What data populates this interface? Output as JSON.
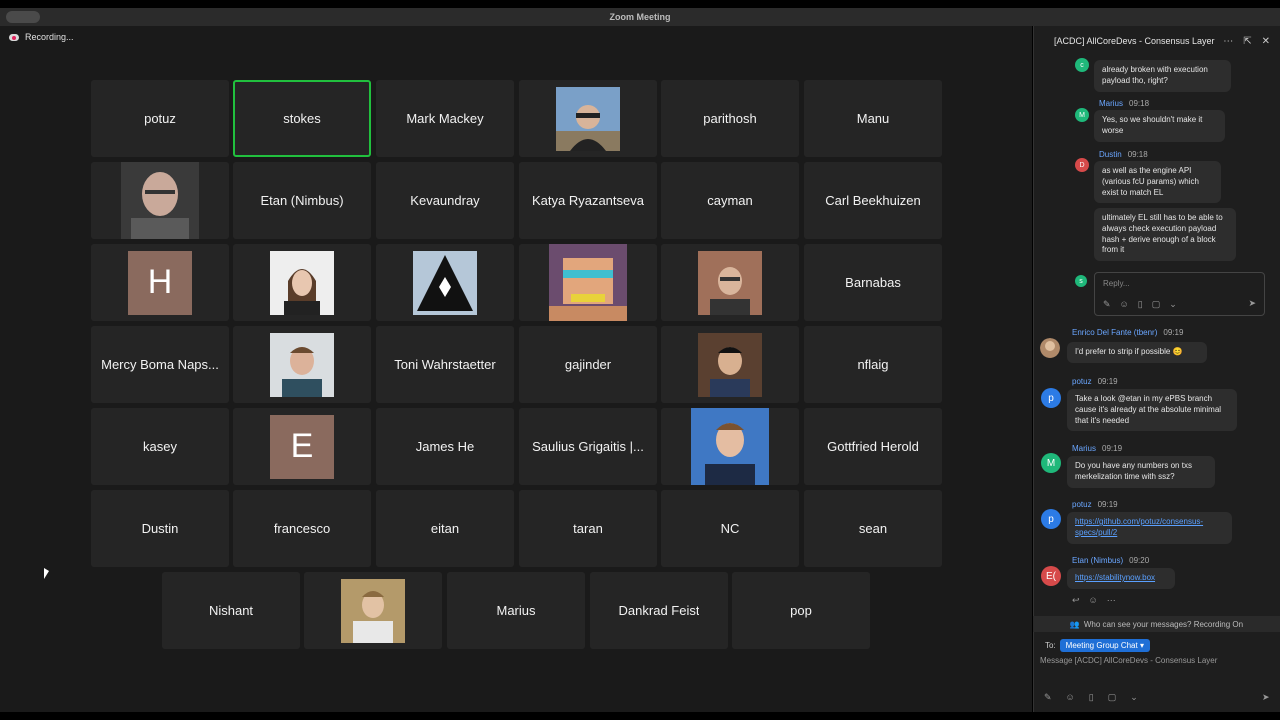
{
  "window": {
    "title": "Zoom Meeting"
  },
  "recording": {
    "label": "Recording..."
  },
  "participants": [
    "potuz",
    "stokes",
    "Mark Mackey",
    "",
    "parithosh",
    "Manu",
    "",
    "Etan (Nimbus)",
    "Kevaundray",
    "Katya Ryazantseva",
    "cayman",
    "Carl Beekhuizen",
    "H",
    "",
    "",
    "",
    "",
    "Barnabas",
    "Mercy Boma Naps...",
    "",
    "Toni Wahrstaetter",
    "gajinder",
    "",
    "nflaig",
    "kasey",
    "E",
    "James He",
    "Saulius Grigaitis |...",
    "",
    "Gottfried Herold",
    "Dustin",
    "francesco",
    "eitan",
    "taran",
    "NC",
    "sean",
    "Nishant",
    "",
    "Marius",
    "Dankrad Feist",
    "pop"
  ],
  "chat": {
    "title": "[ACDC] AllCoreDevs - Consensus Layer",
    "thread": [
      {
        "avatar": "c",
        "sender": "",
        "time": "",
        "text": "already broken with execution payload tho, right?"
      },
      {
        "avatar": "M",
        "sender": "Marius",
        "time": "09:18",
        "text": "Yes, so we shouldn't make it worse"
      },
      {
        "avatar": "D",
        "sender": "Dustin",
        "time": "09:18",
        "text": "as well as the engine API (various fcU params) which exist to match EL"
      },
      {
        "avatar": "",
        "sender": "",
        "time": "",
        "text": "ultimately EL still has to be able to always check execution payload hash + derive enough of a block from it"
      }
    ],
    "reply_placeholder": "Reply...",
    "reply_avatar": "s",
    "messages": [
      {
        "avatar": "",
        "sender": "Enrico Del Fante (tbenr)",
        "time": "09:19",
        "text": "I'd prefer to strip if possible 😊"
      },
      {
        "avatar": "p",
        "sender": "potuz",
        "time": "09:19",
        "text": "Take a look @etan in my ePBS branch cause it's already at the absolute minimal that it's needed"
      },
      {
        "avatar": "M",
        "sender": "Marius",
        "time": "09:19",
        "text": "Do you have any numbers on txs merkelization time with ssz?"
      },
      {
        "avatar": "p",
        "sender": "potuz",
        "time": "09:19",
        "text": "https://github.com/potuz/consensus-specs/pull/2"
      },
      {
        "avatar": "E(",
        "sender": "Etan (Nimbus)",
        "time": "09:20",
        "text": "https://stabilitynow.box"
      }
    ],
    "notice": "Who can see your messages? Recording On",
    "to_label": "To:",
    "to_value": "Meeting Group Chat",
    "compose_placeholder": "Message [ACDC] AllCoreDevs - Consensus Layer"
  },
  "colors": {
    "active_border": "#21c03e",
    "link": "#5aa0ff",
    "pill": "#1f6fd6"
  }
}
